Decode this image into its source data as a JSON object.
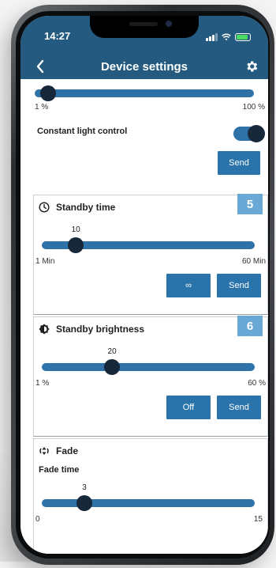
{
  "status_bar": {
    "time": "14:27"
  },
  "header": {
    "title": "Device settings"
  },
  "brightness_range": {
    "min_label": "1 %",
    "max_label": "100 %",
    "value_fraction": 0.06
  },
  "constant_light": {
    "label": "Constant light control",
    "toggle_on": true,
    "send_label": "Send"
  },
  "standby_time": {
    "title": "Standby time",
    "badge": "5",
    "value": "10",
    "min_label": "1 Min",
    "max_label": "60 Min",
    "value_fraction": 0.16,
    "infinity_label": "∞",
    "send_label": "Send"
  },
  "standby_brightness": {
    "title": "Standby brightness",
    "badge": "6",
    "value": "20",
    "min_label": "1 %",
    "max_label": "60 %",
    "value_fraction": 0.33,
    "off_label": "Off",
    "send_label": "Send"
  },
  "fade": {
    "title": "Fade",
    "subtitle": "Fade time",
    "value": "3",
    "min_label": "0",
    "max_label": "15",
    "value_fraction": 0.2
  },
  "colors": {
    "accent": "#2a73ab",
    "header": "#245a7f",
    "thumb": "#16283a",
    "badge": "#6aa8d6"
  }
}
